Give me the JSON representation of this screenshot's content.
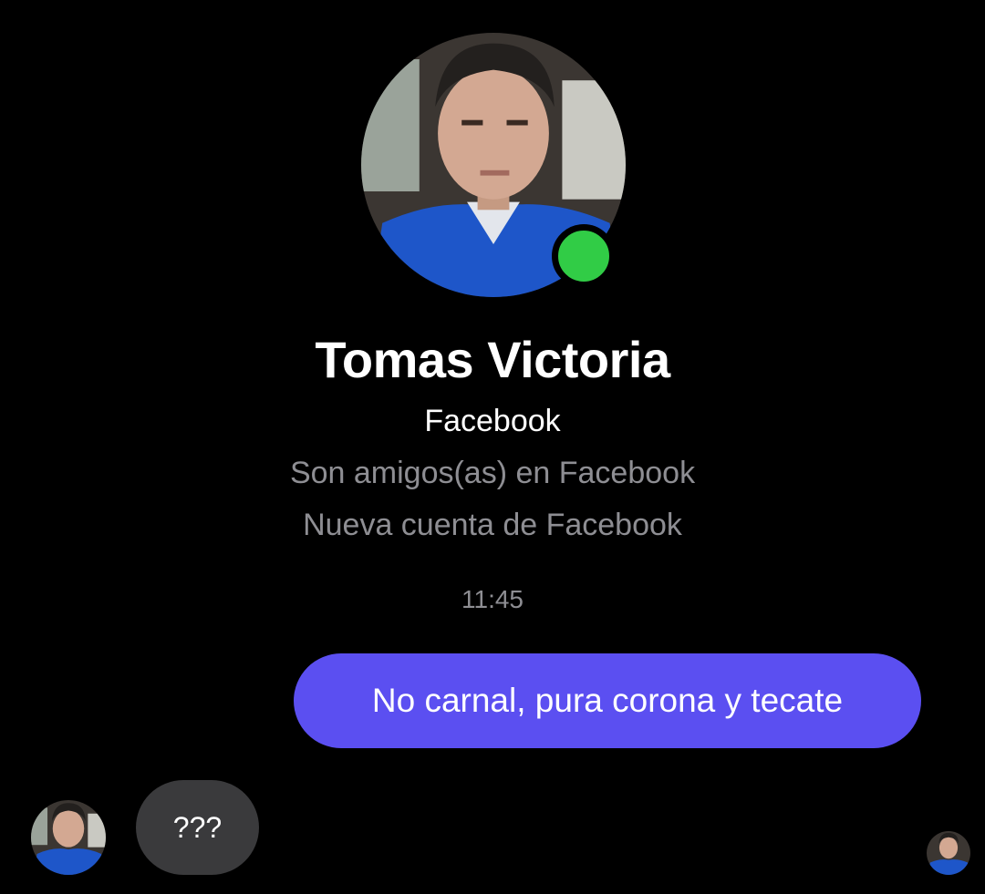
{
  "contact": {
    "name": "Tomas Victoria",
    "platform": "Facebook",
    "details": [
      "Son amigos(as) en Facebook",
      "Nueva cuenta de Facebook"
    ],
    "online": true
  },
  "conversation": {
    "timestamp": "11:45",
    "messages": [
      {
        "from": "me",
        "text": "No carnal, pura corona y tecate"
      },
      {
        "from": "contact",
        "text": "???"
      }
    ]
  },
  "colors": {
    "background": "#000000",
    "outgoing_bubble": "#5b4ff1",
    "incoming_bubble": "#3a3a3c",
    "online_indicator": "#31cc46",
    "secondary_text": "#8e8e93"
  }
}
